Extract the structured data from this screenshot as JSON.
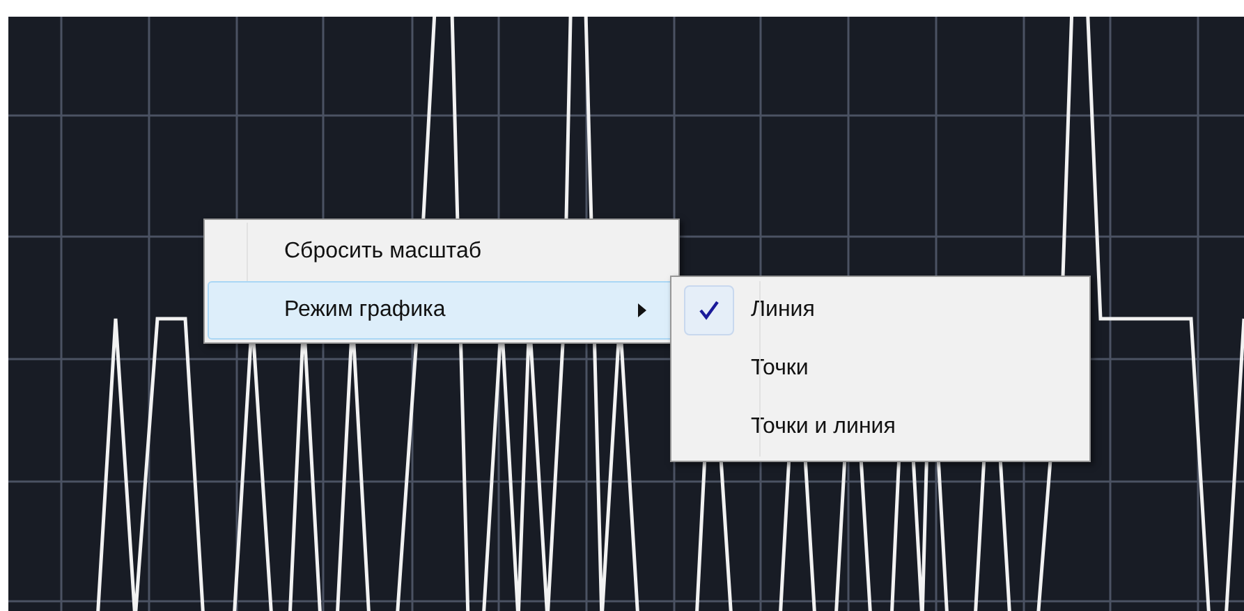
{
  "context_menu": {
    "items": [
      {
        "label": "Сбросить масштаб",
        "highlighted": false,
        "submenu": false
      },
      {
        "label": "Режим графика",
        "highlighted": true,
        "submenu": true
      }
    ]
  },
  "submenu": {
    "items": [
      {
        "label": "Линия",
        "selected": true
      },
      {
        "label": "Точки",
        "selected": false
      },
      {
        "label": "Точки и линия",
        "selected": false
      }
    ]
  }
}
